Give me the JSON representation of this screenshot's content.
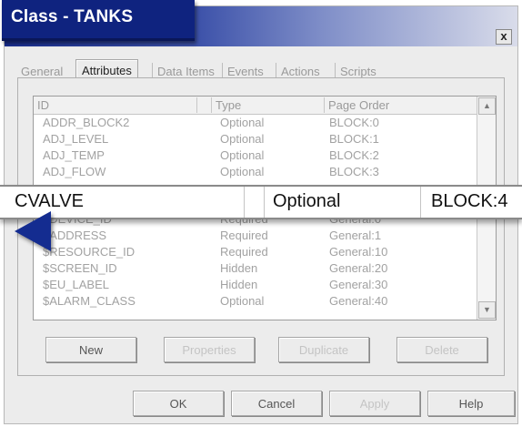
{
  "window": {
    "title": "Class - TANKS",
    "close_label": "x"
  },
  "tabs": [
    {
      "label": "General"
    },
    {
      "label": "Attributes"
    },
    {
      "label": "Data Items"
    },
    {
      "label": "Events"
    },
    {
      "label": "Actions"
    },
    {
      "label": "Scripts"
    }
  ],
  "table": {
    "columns": [
      "ID",
      "Type",
      "Page Order"
    ],
    "rows_top": [
      {
        "id": "ADDR_BLOCK2",
        "type": "Optional",
        "order": "BLOCK:0"
      },
      {
        "id": "ADJ_LEVEL",
        "type": "Optional",
        "order": "BLOCK:1"
      },
      {
        "id": "ADJ_TEMP",
        "type": "Optional",
        "order": "BLOCK:2"
      },
      {
        "id": "ADJ_FLOW",
        "type": "Optional",
        "order": "BLOCK:3"
      }
    ],
    "selected_row": {
      "id": "CVALVE",
      "type": "Optional",
      "order": "BLOCK:4"
    },
    "rows_bottom": [
      {
        "id": "$DEVICE_ID",
        "type": "Required",
        "order": "General:0"
      },
      {
        "id": "$ADDRESS",
        "type": "Required",
        "order": "General:1"
      },
      {
        "id": "$RESOURCE_ID",
        "type": "Required",
        "order": "General:10"
      },
      {
        "id": "$SCREEN_ID",
        "type": "Hidden",
        "order": "General:20"
      },
      {
        "id": "$EU_LABEL",
        "type": "Hidden",
        "order": "General:30"
      },
      {
        "id": "$ALARM_CLASS",
        "type": "Optional",
        "order": "General:40"
      }
    ],
    "scroll_up": "▲",
    "scroll_down": "▼"
  },
  "actions": {
    "new": "New",
    "properties": "Properties",
    "duplicate": "Duplicate",
    "delete": "Delete"
  },
  "footer": {
    "ok": "OK",
    "cancel": "Cancel",
    "apply": "Apply",
    "help": "Help"
  },
  "colors": {
    "title_bg": "#0f237f",
    "pointer_arrow": "#142c90"
  }
}
